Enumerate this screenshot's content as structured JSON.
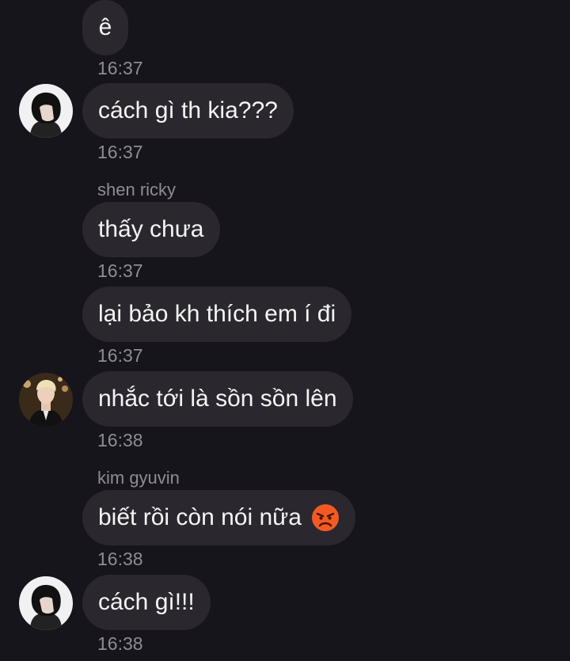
{
  "messages": [
    {
      "text": "ê",
      "time": "16:37"
    },
    {
      "text": "cách gì th kia???",
      "time": "16:37"
    },
    {
      "sender": "shen ricky",
      "text": "thấy chưa",
      "time": "16:37"
    },
    {
      "text": "lại bảo kh thích em í đi",
      "time": "16:37"
    },
    {
      "text": "nhắc tới là sồn sồn lên",
      "time": "16:38"
    },
    {
      "sender": "kim gyuvin",
      "text": "biết rồi còn nói nữa",
      "emoji": "angry-face-icon",
      "time": "16:38"
    },
    {
      "text": "cách gì!!!",
      "time": "16:38"
    }
  ],
  "colors": {
    "background": "#17151c",
    "bubble": "#2a282e",
    "text": "#f4f4f4",
    "meta_text": "#8e8d92",
    "emoji": "#f25a23"
  }
}
